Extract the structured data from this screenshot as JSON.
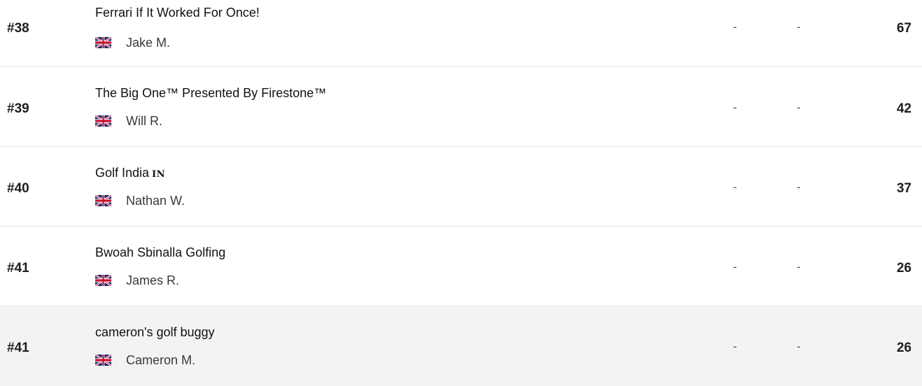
{
  "rows": [
    {
      "rank": "#38",
      "team": "Ferrari If It Worked For Once!",
      "tag": "",
      "manager": "Jake M.",
      "flag_icon": "uk-flag-icon",
      "col1": "-",
      "col2": "-",
      "points": "67"
    },
    {
      "rank": "#39",
      "team": "The Big One™ Presented By Firestone™",
      "tag": "",
      "manager": "Will R.",
      "flag_icon": "uk-flag-icon",
      "col1": "-",
      "col2": "-",
      "points": "42"
    },
    {
      "rank": "#40",
      "team": "Golf India",
      "tag": "IN",
      "manager": "Nathan W.",
      "flag_icon": "uk-flag-icon",
      "col1": "-",
      "col2": "-",
      "points": "37"
    },
    {
      "rank": "#41",
      "team": "Bwoah Sbinalla Golfing",
      "tag": "",
      "manager": "James R.",
      "flag_icon": "uk-flag-icon",
      "col1": "-",
      "col2": "-",
      "points": "26"
    },
    {
      "rank": "#41",
      "team": "cameron's golf buggy",
      "tag": "",
      "manager": "Cameron M.",
      "flag_icon": "uk-flag-icon",
      "col1": "-",
      "col2": "-",
      "points": "26"
    }
  ],
  "colors": {
    "row_border": "#e4e4e4",
    "hover_row_background": "#f3f3f3",
    "flag_blue": "#012169",
    "flag_red": "#C8102E"
  }
}
